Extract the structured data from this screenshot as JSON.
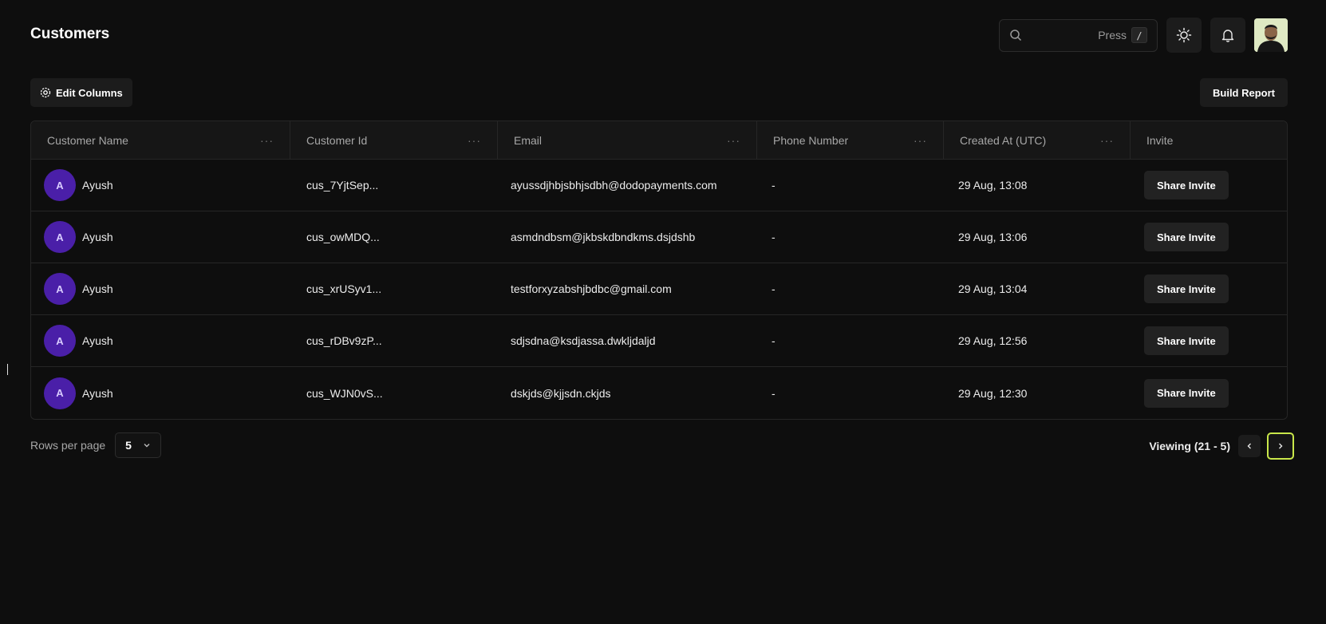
{
  "header": {
    "title": "Customers",
    "search_hint": "Press",
    "search_shortcut": "/"
  },
  "toolbar": {
    "edit_columns_label": "Edit Columns",
    "build_report_label": "Build Report"
  },
  "table": {
    "columns": [
      "Customer Name",
      "Customer Id",
      "Email",
      "Phone Number",
      "Created At (UTC)",
      "Invite"
    ],
    "rows": [
      {
        "initial": "A",
        "name": "Ayush",
        "id": "cus_7YjtSep...",
        "email": "ayussdjhbjsbhjsdbh@dodopayments.com",
        "phone": "-",
        "created": "29 Aug, 13:08",
        "invite": "Share Invite"
      },
      {
        "initial": "A",
        "name": "Ayush",
        "id": "cus_owMDQ...",
        "email": "asmdndbsm@jkbskdbndkms.dsjdshb",
        "phone": "-",
        "created": "29 Aug, 13:06",
        "invite": "Share Invite"
      },
      {
        "initial": "A",
        "name": "Ayush",
        "id": "cus_xrUSyv1...",
        "email": "testforxyzabshjbdbc@gmail.com",
        "phone": "-",
        "created": "29 Aug, 13:04",
        "invite": "Share Invite"
      },
      {
        "initial": "A",
        "name": "Ayush",
        "id": "cus_rDBv9zP...",
        "email": "sdjsdna@ksdjassa.dwkljdaljd",
        "phone": "-",
        "created": "29 Aug, 12:56",
        "invite": "Share Invite"
      },
      {
        "initial": "A",
        "name": "Ayush",
        "id": "cus_WJN0vS...",
        "email": "dskjds@kjjsdn.ckjds",
        "phone": "-",
        "created": "29 Aug, 12:30",
        "invite": "Share Invite"
      }
    ]
  },
  "footer": {
    "rows_per_page_label": "Rows per page",
    "rows_per_page_value": "5",
    "viewing_text": "Viewing (21 - 5)"
  },
  "colors": {
    "background": "#0e0e0e",
    "avatar_purple": "#4a1fa8",
    "active_page_outline": "#c9e74a"
  },
  "icons": [
    "search-icon",
    "sun-icon",
    "bell-icon",
    "gear-icon",
    "ellipsis-icon",
    "chevron-down-icon",
    "chevron-left-icon",
    "chevron-right-icon"
  ]
}
